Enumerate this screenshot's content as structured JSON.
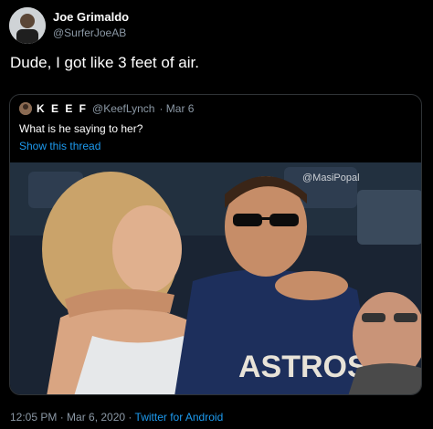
{
  "tweet": {
    "author_name": "Joe Grimaldo",
    "author_handle": "@SurferJoeAB",
    "text": "Dude, I got like 3 feet of air.",
    "timestamp": "12:05 PM · Mar 6, 2020",
    "separator": " · ",
    "source": "Twitter for Android"
  },
  "quoted": {
    "author_name": "K E E F",
    "author_handle": "@KeefLynch",
    "date": " · Mar 6",
    "text": "What is he saying to her?",
    "show_thread": "Show this thread",
    "watermark": "@MasiPopal",
    "shirt_text": "ASTROS"
  },
  "colors": {
    "background": "#000000",
    "link": "#1d9bf0",
    "secondary_text": "#8b98a5",
    "border": "#2f3336"
  }
}
